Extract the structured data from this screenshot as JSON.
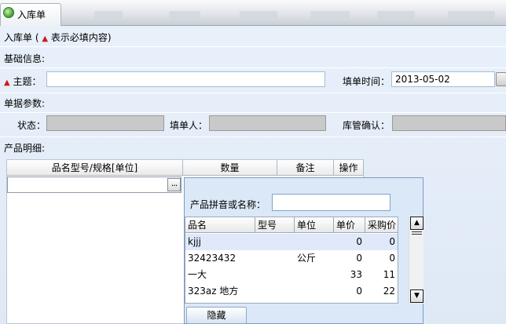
{
  "window": {
    "title": "入库单"
  },
  "form": {
    "heading": "入库单 (",
    "heading_note": "表示必填内容)",
    "section_basic": "基础信息:",
    "subject_label": "主题：",
    "subject_value": "",
    "fill_time_label": "填单时间：",
    "fill_time_value": "2013-05-02",
    "section_params": "单据参数:",
    "status_label": "状态：",
    "filler_label": "填单人：",
    "warehouse_label": "库管确认：",
    "section_details": "产品明细:"
  },
  "grid": {
    "columns": [
      "品名型号/规格[单位]",
      "数量",
      "备注",
      "操作"
    ],
    "ellipsis_label": "..."
  },
  "dropdown": {
    "search_label": "产品拼音或名称：",
    "search_value": "",
    "columns": [
      "品名",
      "型号",
      "单位",
      "单价",
      "采购价"
    ],
    "rows": [
      {
        "name": "kjjj",
        "model": "",
        "unit": "",
        "price": "0",
        "purchase": "0"
      },
      {
        "name": "32423432",
        "model": "",
        "unit": "公斤",
        "price": "0",
        "purchase": "0"
      },
      {
        "name": "一大",
        "model": "",
        "unit": "",
        "price": "33",
        "purchase": "11"
      },
      {
        "name": "323az 地方",
        "model": "",
        "unit": "",
        "price": "0",
        "purchase": "22"
      }
    ],
    "hide_button": "隐藏"
  },
  "colors": {
    "required_marker": "#cc1a1a",
    "background": "#e4eef9"
  }
}
